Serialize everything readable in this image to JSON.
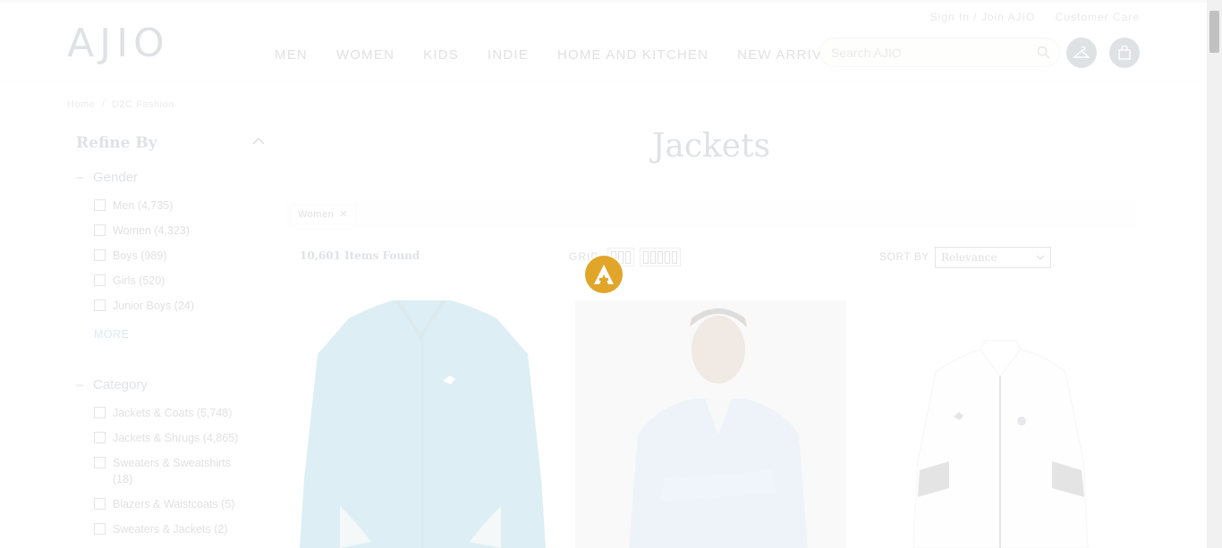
{
  "header": {
    "logo": "AJIO",
    "top_links": [
      "Sign In / Join AJIO",
      "Customer Care"
    ],
    "nav": [
      "MEN",
      "WOMEN",
      "KIDS",
      "INDIE",
      "HOME AND KITCHEN",
      "NEW ARRIVALS"
    ],
    "search_placeholder": "Search AJIO"
  },
  "breadcrumb": [
    "Home",
    "/",
    "D2C Fashion"
  ],
  "sidebar": {
    "title": "Refine By",
    "gender": {
      "title": "Gender",
      "options": [
        "Men (4,735)",
        "Women (4,323)",
        "Boys (989)",
        "Girls (520)",
        "Junior Boys (24)"
      ],
      "more": "MORE"
    },
    "category": {
      "title": "Category",
      "options": [
        "Jackets & Coats (5,748)",
        "Jackets & Shrugs (4,865)",
        "Sweaters & Sweatshirts (18)",
        "Blazers & Waistcoats (5)",
        "Sweaters & Jackets (2)"
      ]
    }
  },
  "main": {
    "heading": "Jackets",
    "active_filter": "Women",
    "items_found": "10,601 Items Found",
    "grid_label": "GRID",
    "sort_label": "SORT BY",
    "sort_value": "Relevance"
  },
  "colors": {
    "brand_navy": "#2c4152",
    "loader_orange": "#e1a52a",
    "jacket_blue": "#1e8fb8"
  }
}
